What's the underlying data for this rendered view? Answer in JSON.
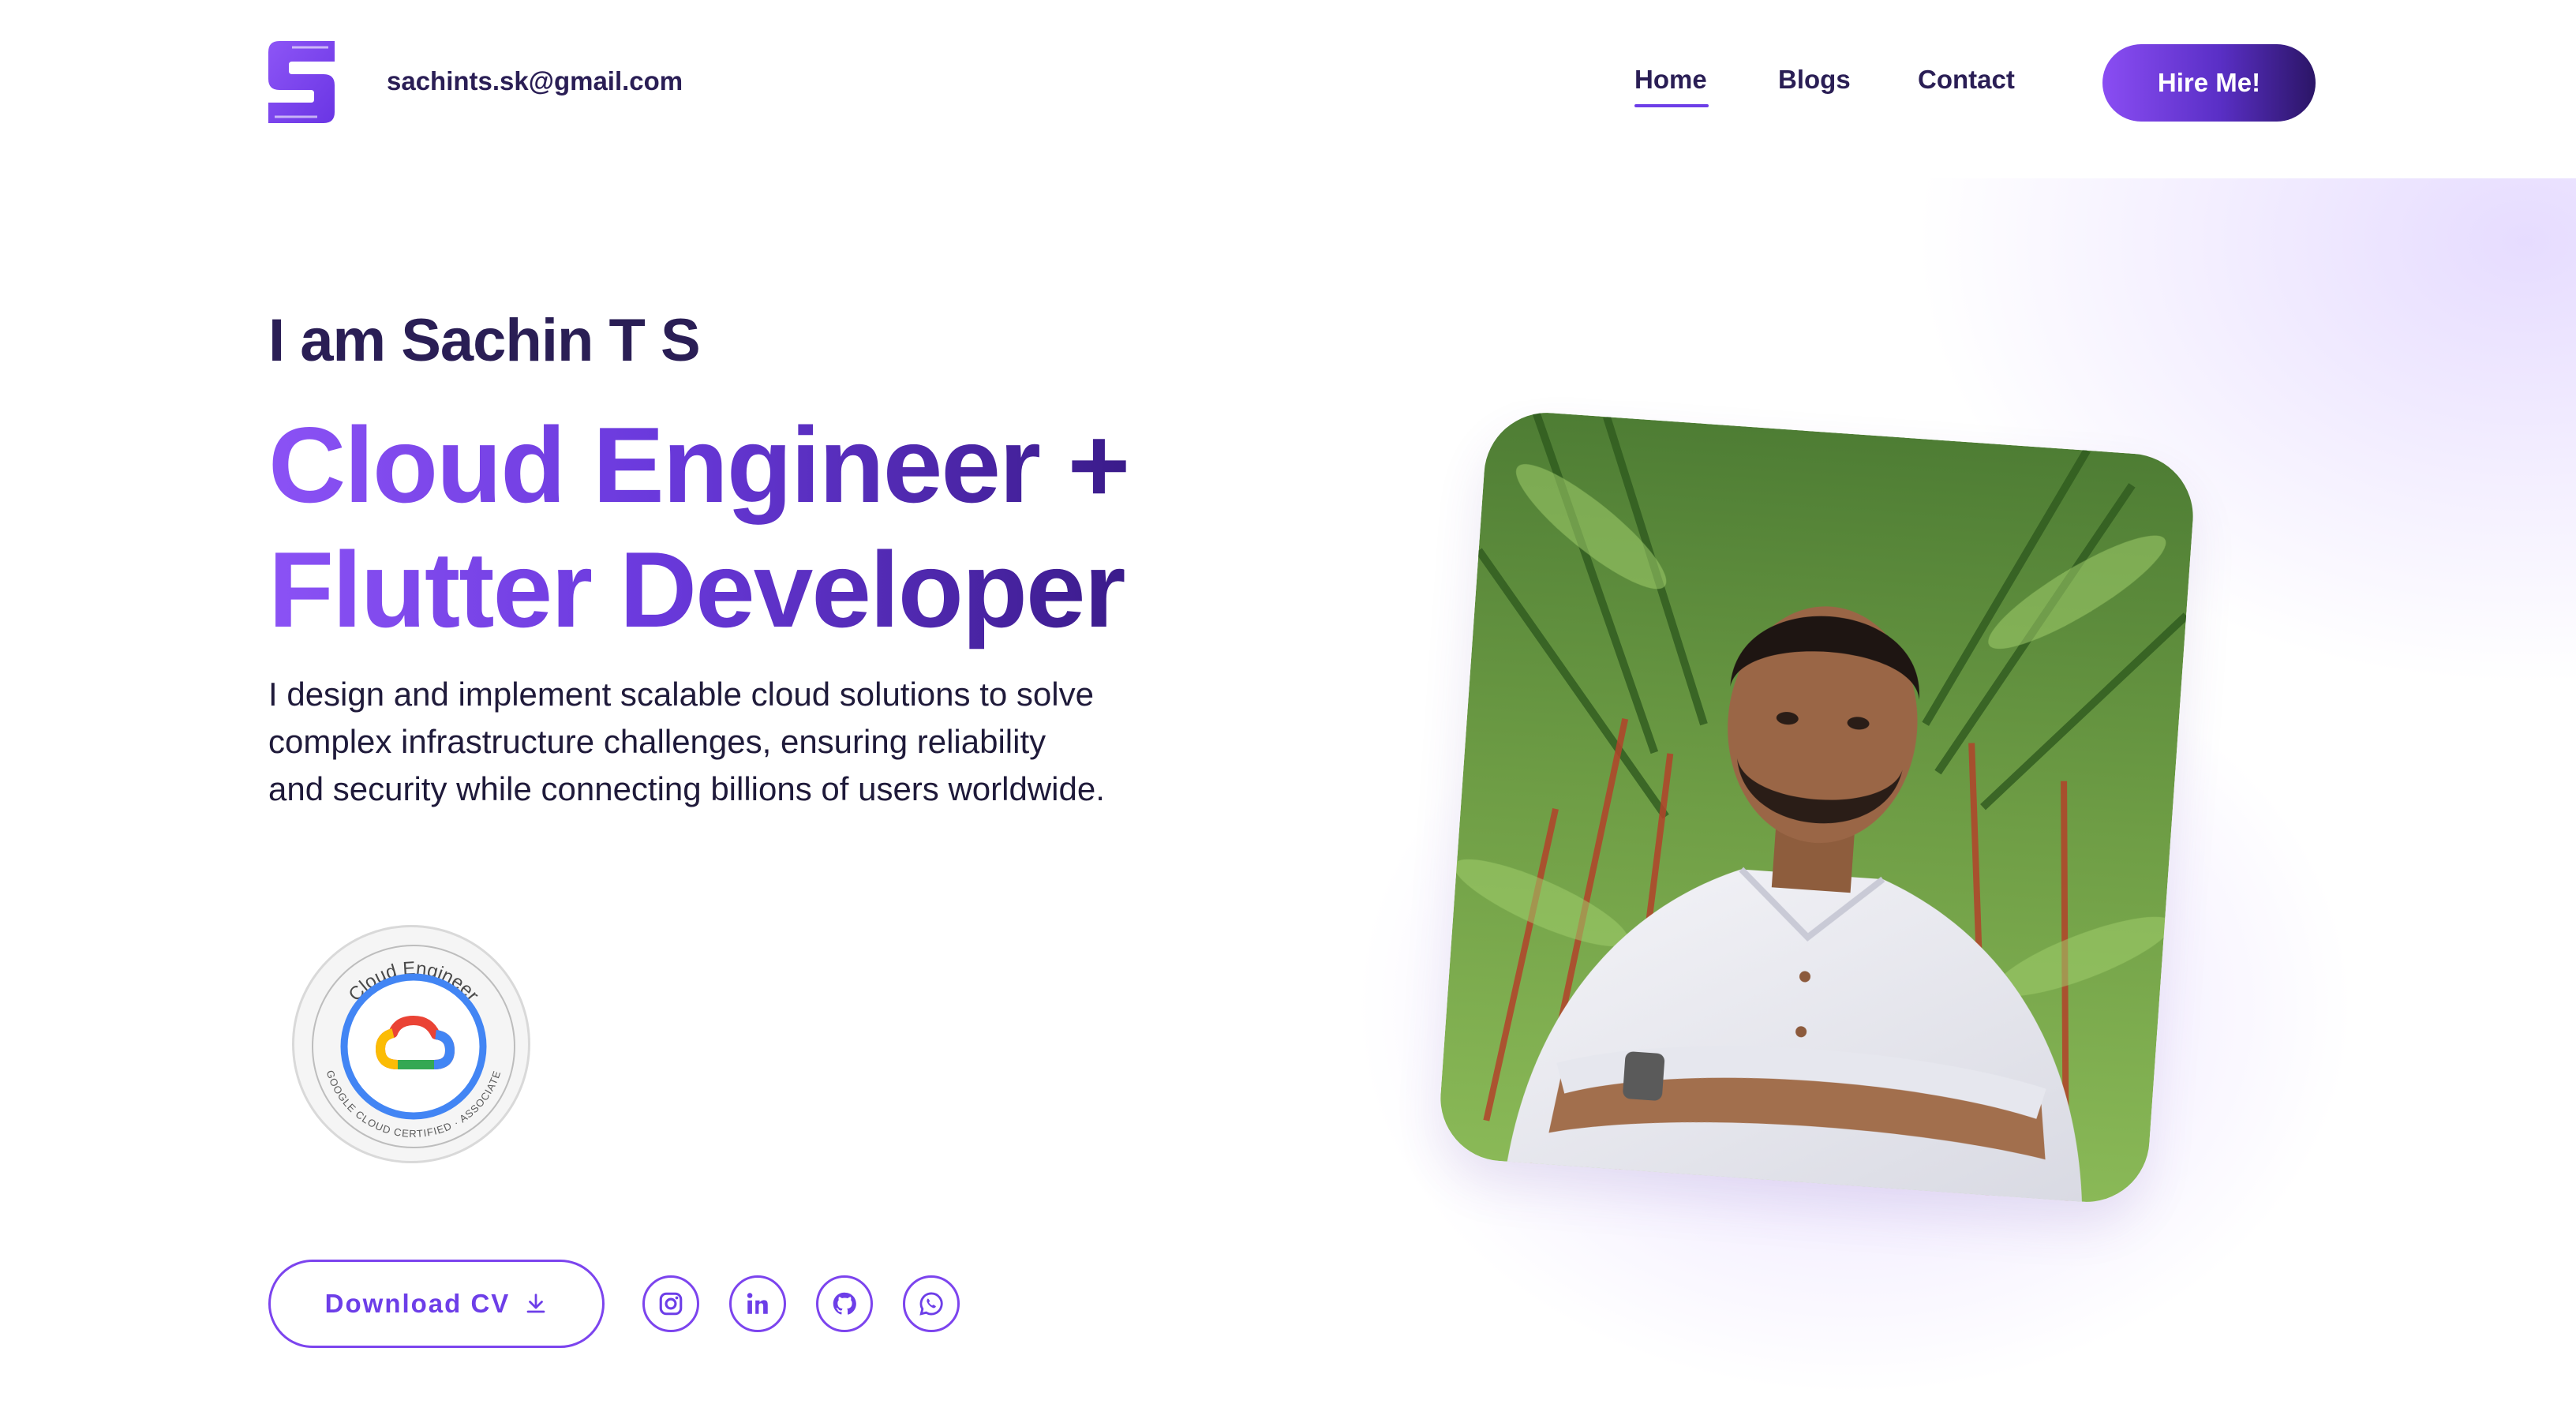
{
  "header": {
    "logo_icon": "s-logo-icon",
    "email": "sachints.sk@gmail.com",
    "nav": {
      "home": "Home",
      "blogs": "Blogs",
      "contact": "Contact"
    },
    "hire_label": "Hire Me!"
  },
  "hero": {
    "intro": "I am Sachin T S",
    "headline_line1": "Cloud Engineer +",
    "headline_line2": "Flutter Developer",
    "description": "I design and implement scalable cloud solutions to solve complex infrastructure challenges, ensuring reliability and security while connecting billions of users worldwide.",
    "badge": {
      "top_text": "Cloud Engineer",
      "bottom_text": "GOOGLE CLOUD CERTIFIED · ASSOCIATE"
    },
    "download_label": "Download CV",
    "social_icons": [
      "instagram-icon",
      "linkedin-icon",
      "github-icon",
      "whatsapp-icon"
    ]
  },
  "colors": {
    "accent": "#7c44ee",
    "dark": "#2a1e55",
    "gradient_start": "#8b52f5",
    "gradient_end": "#2b1566"
  }
}
